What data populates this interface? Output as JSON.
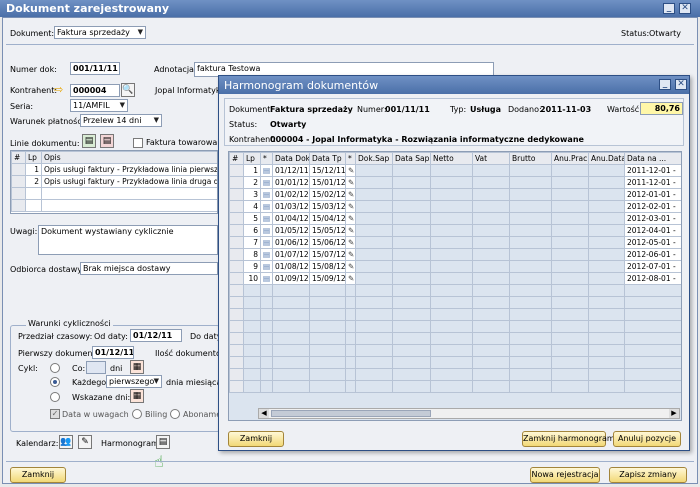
{
  "main_window": {
    "title": "Dokument zarejestrowany",
    "doc_label": "Dokument:",
    "doc_value": "Faktura sprzedaży",
    "status_label": "Status:",
    "status_value": "Otwarty",
    "nr_label": "Numer dok:",
    "nr_value": "001/11/11",
    "adnotacja_label": "Adnotacja:",
    "adnotacja_value": "faktura Testowa",
    "kontrahent_label": "Kontrahent:",
    "kontrahent_value": "000004",
    "kontrahent_name": "Jopal Informatyka",
    "seria_label": "Seria:",
    "seria_value": "11/AMFIL",
    "warunek_label": "Warunek płatności:",
    "warunek_value": "Przelew 14 dni",
    "linie_label": "Linie dokumentu:",
    "faktura_towarowa": "Faktura towarowa",
    "lines_headers": [
      "#",
      "Lp",
      "Opis"
    ],
    "lines": [
      {
        "lp": "1",
        "opis": "Opis usługi faktury - Przykładowa linia pierwsza doku"
      },
      {
        "lp": "2",
        "opis": "Opis usługi faktury - Przykładowa linia druga doku"
      }
    ],
    "uwagi_label": "Uwagi:",
    "uwagi_value": "Dokument wystawiany cyklicznie",
    "odbiorca_label": "Odbiorca dostawy:",
    "odbiorca_value": "Brak miejsca dostawy",
    "warunki_title": "Warunki cykliczności",
    "przedzial_label": "Przedział czasowy:",
    "od_daty_label": "Od daty:",
    "od_daty_value": "01/12/11",
    "do_daty_label": "Do daty",
    "pierwszy_label": "Pierwszy dokument:",
    "pierwszy_value": "01/12/11",
    "ilosc_label": "Ilość dokumentów",
    "cykl_label": "Cykl:",
    "co_label": "Co:",
    "dni_label": "dni",
    "kazdego_label": "Każdego:",
    "kazdego_value": "pierwszego",
    "dnia_miesiaca": "dnia miesiąca",
    "wskazane_label": "Wskazane dni:",
    "data_w_uwagach": "Data w uwagach",
    "biling": "Biling",
    "abonament": "Abonamen",
    "kalendarz_label": "Kalendarz:",
    "harmonogram_label": "Harmonogram:",
    "zamknij": "Zamknij",
    "nowa_rejestracja": "Nowa rejestracja",
    "zapisz_zmiany": "Zapisz zmiany"
  },
  "harmonogram": {
    "title": "Harmonogram dokumentów",
    "dokument_label": "Dokument:",
    "dokument_value": "Faktura sprzedaży",
    "numer_label": "Numer:",
    "numer_value": "001/11/11",
    "typ_label": "Typ:",
    "typ_value": "Usługa",
    "dodano_label": "Dodano:",
    "dodano_value": "2011-11-03",
    "wartosc_label": "Wartość:",
    "wartosc_value": "80,76",
    "status_label": "Status:",
    "status_value": "Otwarty",
    "kontrahent_label": "Kontrahent:",
    "kontrahent_value": "000004 - Jopal Informatyka - Rozwiązania informatyczne dedykowane",
    "headers": [
      "#",
      "Lp",
      "*",
      "Data Dok",
      "Data Tp",
      "*",
      "Dok.Sap",
      "Data Sap",
      "Netto",
      "Vat",
      "Brutto",
      "Anu.Prac",
      "Anu.Data",
      "Data na ..."
    ],
    "rows": [
      {
        "lp": "1",
        "dok": "01/12/11",
        "tp": "15/12/11",
        "na": "2011-12-01 -"
      },
      {
        "lp": "2",
        "dok": "01/01/12",
        "tp": "15/01/12",
        "na": "2011-12-01 -"
      },
      {
        "lp": "3",
        "dok": "01/02/12",
        "tp": "15/02/12",
        "na": "2012-01-01 -"
      },
      {
        "lp": "4",
        "dok": "01/03/12",
        "tp": "15/03/12",
        "na": "2012-02-01 -"
      },
      {
        "lp": "5",
        "dok": "01/04/12",
        "tp": "15/04/12",
        "na": "2012-03-01 -"
      },
      {
        "lp": "6",
        "dok": "01/05/12",
        "tp": "15/05/12",
        "na": "2012-04-01 -"
      },
      {
        "lp": "7",
        "dok": "01/06/12",
        "tp": "15/06/12",
        "na": "2012-05-01 -"
      },
      {
        "lp": "8",
        "dok": "01/07/12",
        "tp": "15/07/12",
        "na": "2012-06-01 -"
      },
      {
        "lp": "9",
        "dok": "01/08/12",
        "tp": "15/08/12",
        "na": "2012-07-01 -"
      },
      {
        "lp": "10",
        "dok": "01/09/12",
        "tp": "15/09/12",
        "na": "2012-08-01 -"
      }
    ],
    "zamknij": "Zamknij",
    "zamknij_harmonogram": "Zamknij harmonogram",
    "anuluj_pozycje": "Anuluj pozycje"
  }
}
